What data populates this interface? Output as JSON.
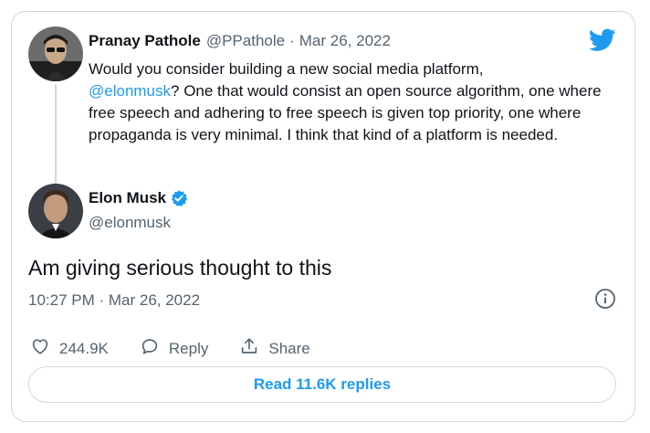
{
  "quoted_tweet": {
    "display_name": "Pranay Pathole",
    "handle": "@PPathole",
    "separator": "·",
    "date": "Mar 26, 2022",
    "text_prefix": "Would you consider building a new social media platform,",
    "mention": "@elonmusk",
    "text_suffix": "? One that would consist an open source algorithm, one where free speech and adhering to free speech is given top priority, one where propaganda is very minimal. I think that kind of a platform is needed."
  },
  "main_tweet": {
    "display_name": "Elon Musk",
    "handle": "@elonmusk",
    "verified_icon": "verified-badge-icon",
    "text": "Am giving serious thought to this",
    "timestamp": "10:27 PM · Mar 26, 2022"
  },
  "actions": {
    "like_count": "244.9K",
    "reply_label": "Reply",
    "share_label": "Share"
  },
  "read_replies_label": "Read 11.6K replies",
  "colors": {
    "accent": "#1d9bf0",
    "text": "#0f1419",
    "muted": "#536471",
    "border": "#cfd9de"
  },
  "icons": [
    "twitter-bird-icon",
    "info-icon",
    "heart-icon",
    "reply-icon",
    "share-icon"
  ]
}
